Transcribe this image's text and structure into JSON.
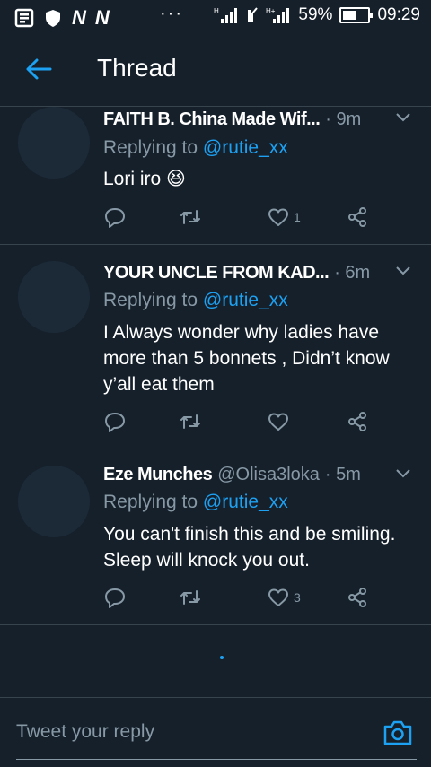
{
  "status_bar": {
    "carrier_letters": [
      "N",
      "N"
    ],
    "dots": "···",
    "battery": "59%",
    "time": "09:29",
    "signal_icons": [
      "signal-icon",
      "data-icon",
      "signal-icon"
    ]
  },
  "header": {
    "title": "Thread"
  },
  "tweets": [
    {
      "name": "FAITH B. China Made Wif...",
      "handle": "",
      "time": "· 9m",
      "replying_prefix": "Replying to ",
      "replying_handle": "@rutie_xx",
      "text": "Lori iro 😆",
      "like_count": "1"
    },
    {
      "name": "YOUR UNCLE FROM KAD...",
      "handle": "",
      "time": "· 6m",
      "replying_prefix": "Replying to ",
      "replying_handle": "@rutie_xx",
      "text": "I Always wonder why ladies have more than 5 bonnets , Didn’t know y’all eat them",
      "like_count": ""
    },
    {
      "name": "Eze Munches",
      "handle": "@Olisa3loka",
      "time": "· 5m",
      "replying_prefix": "Replying to ",
      "replying_handle": "@rutie_xx",
      "text": "You can't finish this and be smiling. Sleep will knock you out.",
      "like_count": "3"
    }
  ],
  "compose": {
    "placeholder": "Tweet your reply"
  },
  "colors": {
    "background": "#15202b",
    "accent": "#1da1f2",
    "secondary_text": "#8899a6",
    "divider": "#38444d"
  }
}
